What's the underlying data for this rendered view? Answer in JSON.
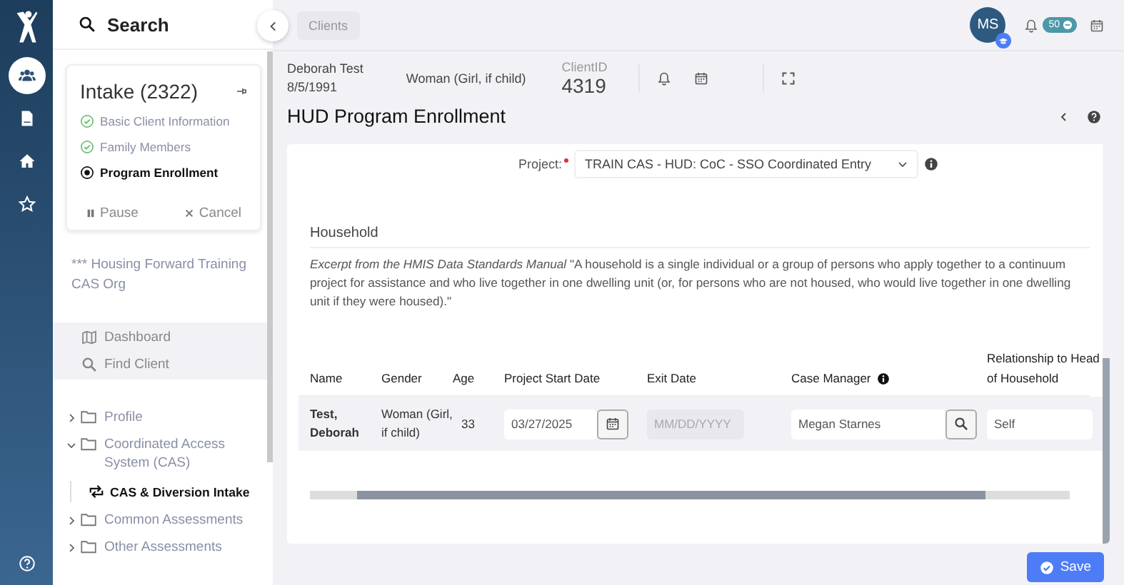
{
  "rail": {
    "items": [
      {
        "kind": "people",
        "selected": true
      },
      {
        "kind": "document",
        "selected": false
      },
      {
        "kind": "home",
        "selected": false
      },
      {
        "kind": "star",
        "selected": false
      }
    ]
  },
  "sidebar": {
    "search_label": "Search",
    "workflow": {
      "title": "Intake (2322)",
      "steps": [
        {
          "label": "Basic Client Information",
          "completed": true,
          "selected": false
        },
        {
          "label": "Family Members",
          "completed": true,
          "selected": false
        },
        {
          "label": "Program Enrollment",
          "completed": false,
          "selected": true
        }
      ],
      "pause": "Pause",
      "cancel": "Cancel"
    },
    "organization": "*** Housing Forward Training CAS Org",
    "nav": [
      {
        "kind": "map",
        "label": "Dashboard"
      },
      {
        "kind": "search",
        "label": "Find Client"
      }
    ],
    "tree": [
      {
        "label": "Profile",
        "expanded": false
      },
      {
        "label": "Coordinated Access System (CAS)",
        "expanded": true,
        "children": [
          {
            "label": "CAS & Diversion Intake",
            "selected": true
          }
        ]
      },
      {
        "label": "Common Assessments",
        "expanded": false
      },
      {
        "label": "Other Assessments",
        "expanded": false
      }
    ]
  },
  "topbar": {
    "breadcrumb": "Clients",
    "avatar_initials": "MS",
    "notification_count": "50"
  },
  "client": {
    "name": "Deborah Test",
    "dob": "8/5/1991",
    "gender": "Woman (Girl, if child)",
    "id_label": "ClientID",
    "id": "4319"
  },
  "page_title": "HUD Program Enrollment",
  "form": {
    "project_label": "Project:",
    "project_required": true,
    "project_value": "TRAIN CAS - HUD: CoC - SSO Coordinated Entry",
    "household_heading": "Household",
    "household_note": "*Excerpt from the HMIS Data Standards Manual* \"A household is a single individual or a group of persons who apply together to a continuum project for assistance and who live together in one dwelling unit (or, for persons who are not housed, who would live together in one dwelling unit if they were housed).\"",
    "table": {
      "columns": [
        "Name",
        "Gender",
        "Age",
        "Project Start Date",
        "Exit Date",
        "Case Manager",
        "Relationship to Head of Household"
      ],
      "rows": [
        {
          "name": "Test, Deborah",
          "gender": "Woman (Girl, if child)",
          "age": "33",
          "start_date": "03/27/2025",
          "exit_placeholder": "MM/DD/YYYY",
          "case_manager": "Megan Starnes",
          "relationship": "Self"
        }
      ]
    }
  },
  "save_label": "Save"
}
